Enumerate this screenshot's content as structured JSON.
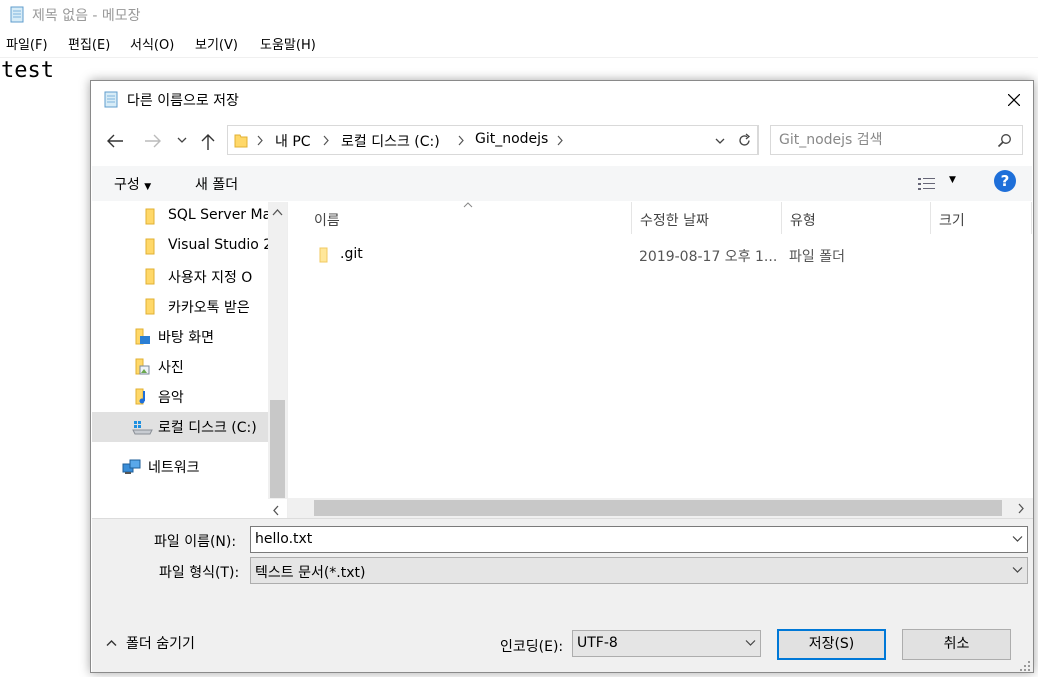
{
  "notepad": {
    "title": "제목 없음 - 메모장",
    "menu": [
      "파일(F)",
      "편집(E)",
      "서식(O)",
      "보기(V)",
      "도움말(H)"
    ],
    "content": "test"
  },
  "dialog": {
    "title": "다른 이름으로 저장",
    "address": {
      "segments": [
        "내 PC",
        "로컬 디스크 (C:)",
        "Git_nodejs"
      ]
    },
    "search": {
      "placeholder": "Git_nodejs 검색"
    },
    "toolbar": {
      "organize": "구성",
      "new_folder": "새 폴더"
    },
    "tree": [
      {
        "label": "SQL Server Ma",
        "icon": "folder-icon"
      },
      {
        "label": "Visual Studio 2",
        "icon": "folder-icon"
      },
      {
        "label": "사용자 지정 O",
        "icon": "folder-icon"
      },
      {
        "label": "카카오톡 받은",
        "icon": "folder-icon"
      },
      {
        "label": "바탕 화면",
        "icon": "desktop-icon"
      },
      {
        "label": "사진",
        "icon": "pictures-icon"
      },
      {
        "label": "음악",
        "icon": "music-icon"
      },
      {
        "label": "로컬 디스크 (C:)",
        "icon": "drive-icon",
        "selected": true
      },
      {
        "label": "네트워크",
        "icon": "network-icon"
      }
    ],
    "columns": [
      "이름",
      "수정한 날짜",
      "유형",
      "크기"
    ],
    "files": [
      {
        "name": ".git",
        "modified": "2019-08-17 오후 1...",
        "type": "파일 폴더",
        "size": ""
      }
    ],
    "filename_label": "파일 이름(N):",
    "filename_value": "hello.txt",
    "filetype_label": "파일 형식(T):",
    "filetype_value": "텍스트 문서(*.txt)",
    "hide_folders": "폴더 숨기기",
    "encoding_label": "인코딩(E):",
    "encoding_value": "UTF-8",
    "save_button": "저장(S)",
    "cancel_button": "취소",
    "colors": {
      "selected": "#e1e1e1",
      "accent": "#0078d7",
      "folder": "#ffd869"
    }
  }
}
